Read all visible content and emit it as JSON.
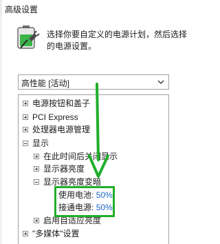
{
  "window": {
    "title": "高级设置"
  },
  "description": {
    "line1": "选择你要自定义的电源计划，然后选择",
    "line2": "的电源设置。"
  },
  "plan_select": {
    "value": "高性能 [活动]",
    "chevron_icon": "chevron-down-icon"
  },
  "tree": {
    "items": [
      {
        "label": "电源按钮和盖子",
        "state": "collapsed"
      },
      {
        "label": "PCI Express",
        "state": "collapsed"
      },
      {
        "label": "处理器电源管理",
        "state": "collapsed"
      },
      {
        "label": "显示",
        "state": "expanded"
      },
      {
        "label": "在此时间后关闭显示",
        "state": "collapsed"
      },
      {
        "label": "显示器亮度",
        "state": "collapsed"
      },
      {
        "label": "显示器亮度变暗",
        "state": "expanded"
      },
      {
        "label": "启用自适应亮度",
        "state": "collapsed"
      },
      {
        "label": "\"多媒体\"设置",
        "state": "collapsed"
      }
    ],
    "settings": [
      {
        "label": "使用电池:",
        "value": "50%"
      },
      {
        "label": "接通电源:",
        "value": "50%"
      }
    ]
  },
  "annotation": {
    "color": "#1fae2b",
    "arrow_icon": "arrow-down-icon"
  },
  "colors": {
    "value_link": "#1a66c8",
    "battery_green": "#3bb54a"
  }
}
